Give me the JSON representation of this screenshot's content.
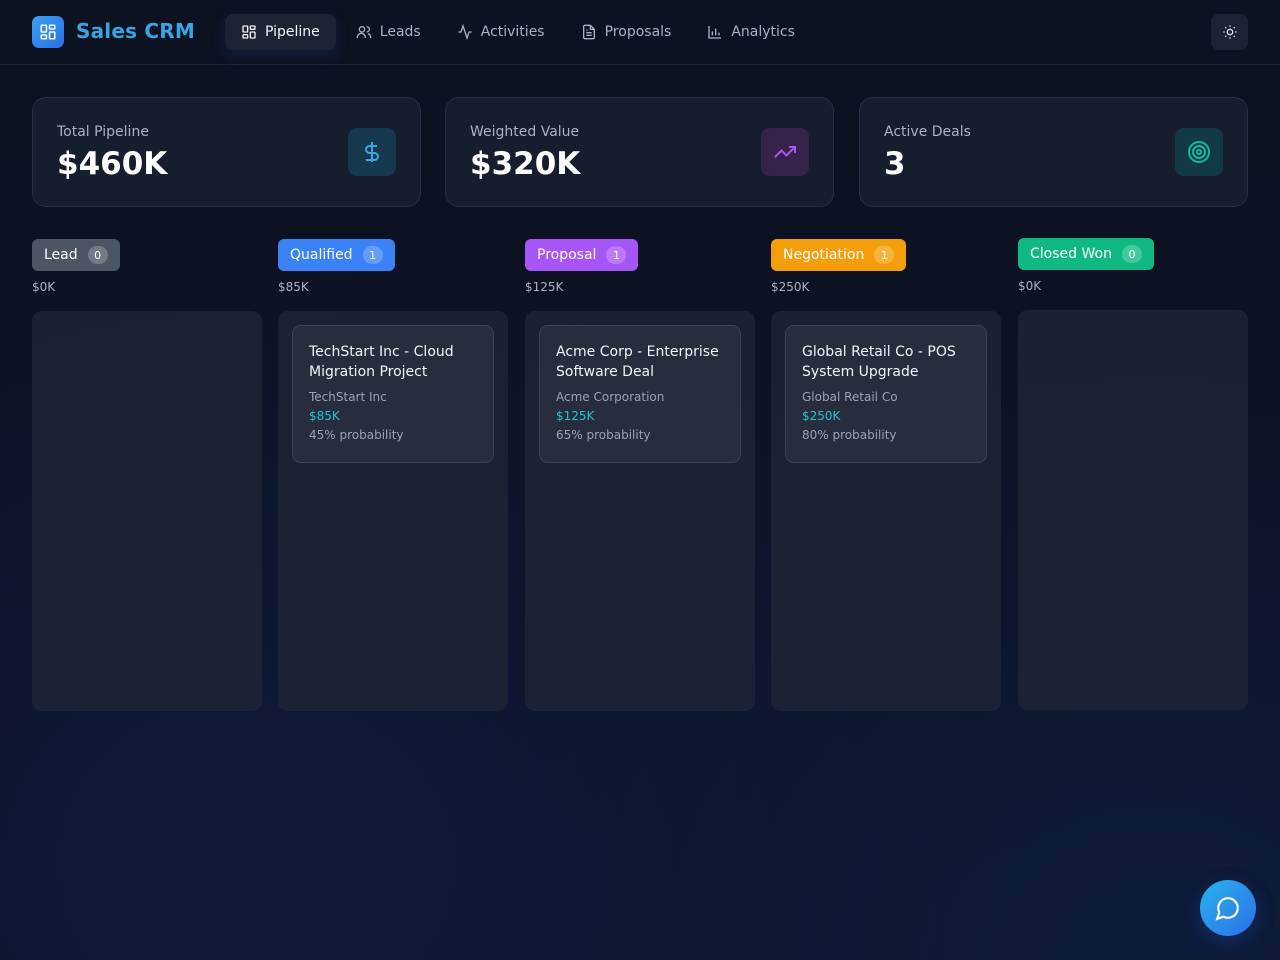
{
  "app": {
    "title": "Sales CRM",
    "logo_icon": "dashboard-grid-icon"
  },
  "nav": [
    {
      "label": "Pipeline",
      "icon": "grid-icon",
      "active": true
    },
    {
      "label": "Leads",
      "icon": "users-icon",
      "active": false
    },
    {
      "label": "Activities",
      "icon": "activity-icon",
      "active": false
    },
    {
      "label": "Proposals",
      "icon": "document-icon",
      "active": false
    },
    {
      "label": "Analytics",
      "icon": "bar-chart-icon",
      "active": false
    }
  ],
  "stats": [
    {
      "label": "Total Pipeline",
      "value": "$460K",
      "icon": "dollar-icon",
      "color": "#38a6e6"
    },
    {
      "label": "Weighted Value",
      "value": "$320K",
      "icon": "trending-up-icon",
      "color": "#a855f7"
    },
    {
      "label": "Active Deals",
      "value": "3",
      "icon": "target-icon",
      "color": "#14b8a6"
    }
  ],
  "stages": [
    {
      "name": "Lead",
      "count": "0",
      "total": "$0K",
      "color": "#4b5563",
      "deals": []
    },
    {
      "name": "Qualified",
      "count": "1",
      "total": "$85K",
      "color": "#3b82f6",
      "deals": [
        {
          "title": "TechStart Inc - Cloud Migration Project",
          "company": "TechStart Inc",
          "value": "$85K",
          "probability": "45% probability"
        }
      ]
    },
    {
      "name": "Proposal",
      "count": "1",
      "total": "$125K",
      "color": "#a855f7",
      "deals": [
        {
          "title": "Acme Corp - Enterprise Software Deal",
          "company": "Acme Corporation",
          "value": "$125K",
          "probability": "65% probability"
        }
      ]
    },
    {
      "name": "Negotiation",
      "count": "1",
      "total": "$250K",
      "color": "#f59e0b",
      "deals": [
        {
          "title": "Global Retail Co - POS System Upgrade",
          "company": "Global Retail Co",
          "value": "$250K",
          "probability": "80% probability"
        }
      ]
    },
    {
      "name": "Closed Won",
      "count": "0",
      "total": "$0K",
      "color": "#10b981",
      "deals": []
    }
  ],
  "theme_toggle_icon": "sun-icon",
  "chat_icon": "chat-bubble-icon"
}
